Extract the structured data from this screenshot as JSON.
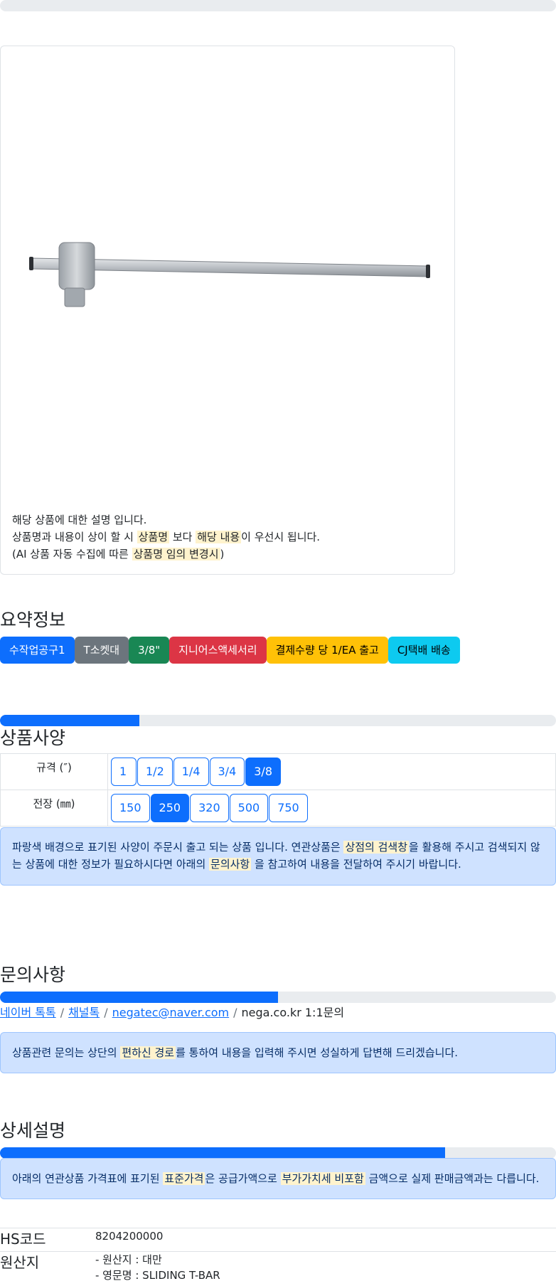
{
  "top_progress": {
    "fraction": 0.0
  },
  "product_image": {
    "alt": "T-bar sliding handle"
  },
  "image_notice": {
    "line1": "해당 상품에 대한 설명 입니다.",
    "line2_a": "상품명과 내용이 상이 할 시 ",
    "line2_hl1": "상품명",
    "line2_b": " 보다 ",
    "line2_hl2": "해당 내용",
    "line2_c": "이 우선시 됩니다.",
    "line3_a": "(AI 상품 자동 수집에 따른 ",
    "line3_hl": "상품명 임의 변경시",
    "line3_b": ")"
  },
  "summary": {
    "title": "요약정보",
    "badges": [
      {
        "label": "수작업공구1",
        "color": "#0d6efd"
      },
      {
        "label": "T소켓대",
        "color": "#6c757d"
      },
      {
        "label": "3/8\"",
        "color": "#198754"
      },
      {
        "label": "지니어스액세서리",
        "color": "#dc3545"
      },
      {
        "label": "결제수량 당 1/EA 출고",
        "color": "#ffc107"
      },
      {
        "label": "CJ택배 배송",
        "color": "#0dcaf0"
      }
    ]
  },
  "spec": {
    "progress": 0.25,
    "title": "상품사양",
    "rows": [
      {
        "label": "규격 (″)",
        "options": [
          "1",
          "1/2",
          "1/4",
          "3/4",
          "3/8"
        ],
        "selected": "3/8"
      },
      {
        "label": "전장 (㎜)",
        "options": [
          "150",
          "250",
          "320",
          "500",
          "750"
        ],
        "selected": "250"
      }
    ],
    "notice_a": "파랑색 배경으로 표기된 사양이 주문시 출고 되는 상품 입니다. 연관상품은 ",
    "notice_hl1": "상점의 검색창",
    "notice_b": "을 활용해 주시고 검색되지 않",
    "notice_c": "는 상품에 대한 정보가 필요하시다면 아래의 ",
    "notice_hl2": "문의사항",
    "notice_d": " 을 참고하여 내용을 전달하여 주시기 바랍니다."
  },
  "inquiry": {
    "title": "문의사항",
    "progress": 0.5,
    "links": [
      "네이버 톡톡",
      "채널톡",
      "negatec@naver.com"
    ],
    "plain": "nega.co.kr 1:1문의",
    "sep": "/",
    "notice_a": "상품관련 문의는 상단의 ",
    "notice_hl": "편하신 경로",
    "notice_b": "를 통하여 내용을 입력해 주시면 성실하게 답변해 드리겠습니다."
  },
  "detail": {
    "title": "상세설명",
    "progress": 0.8,
    "notice_a": "아래의 연관상품 가격표에 표기된 ",
    "notice_hl1": "표준가격",
    "notice_b": "은 공급가액으로 ",
    "notice_hl2": "부가가치세 비포함",
    "notice_c": " 금액으로 실제 판매금액과는 다릅니다.",
    "hs_label": "HS코드",
    "hs_value": "8204200000",
    "origin_label": "원산지",
    "origin_line1": "- 원산지 : 대만",
    "origin_line2": "- 영문명 : SLIDING T-BAR"
  }
}
